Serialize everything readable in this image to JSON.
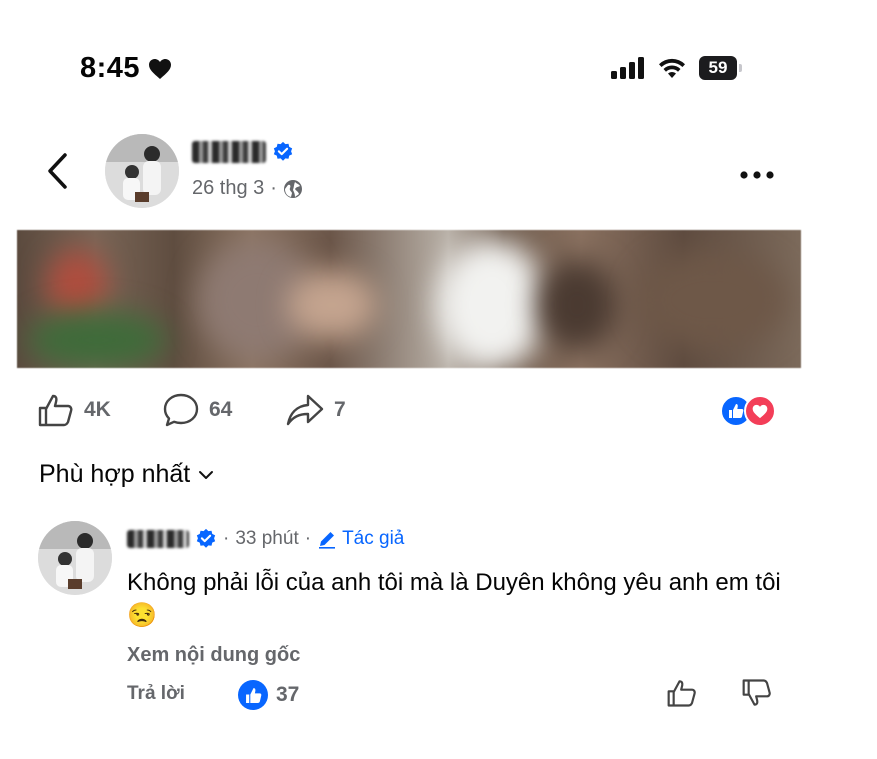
{
  "status_bar": {
    "time": "8:45",
    "battery": "59"
  },
  "post": {
    "date": "26 thg 3",
    "separator": "·",
    "likes": "4K",
    "comments": "64",
    "shares": "7"
  },
  "sort_label": "Phù hợp nhất",
  "comment": {
    "dot": "·",
    "time": "33 phút",
    "author_tag": "Tác giả",
    "text": "Không phải lỗi của anh tôi mà là Duyên không yêu anh em tôi 😒",
    "see_original": "Xem nội dung gốc",
    "reply": "Trả lời",
    "likes": "37"
  },
  "colors": {
    "accent": "#0866ff",
    "secondary_text": "#65676b",
    "love": "#f33e58"
  }
}
